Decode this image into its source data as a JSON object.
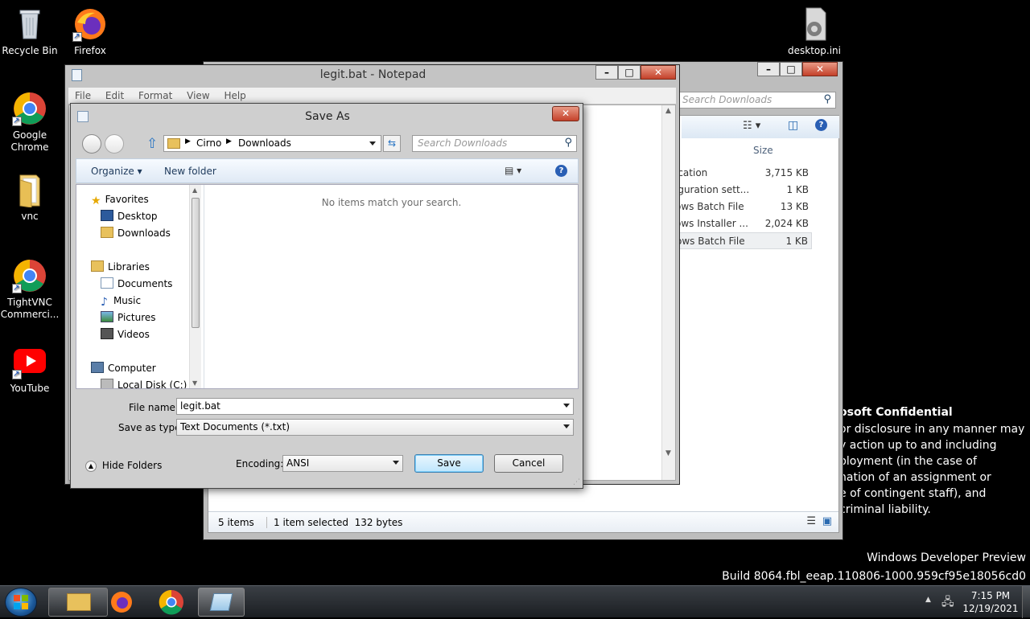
{
  "desktop": {
    "icons": [
      {
        "label": "Recycle Bin"
      },
      {
        "label": "Firefox"
      },
      {
        "label": "Google Chrome"
      },
      {
        "label": "vnc"
      },
      {
        "label": "TightVNC Commerci..."
      },
      {
        "label": "YouTube"
      },
      {
        "label": "desktop.ini"
      }
    ],
    "watermark": {
      "confidential_title": "osoft Confidential",
      "lines": [
        "or disclosure in any manner may",
        "y action up to and including",
        "ployment (in the case of",
        "nation of an assignment or",
        "e of contingent staff), and",
        "criminal liability."
      ],
      "edition": "Windows Developer Preview",
      "build": "Build 8064.fbl_eeap.110806-1000.959cf95e18056cd0"
    }
  },
  "explorer_bg": {
    "search_placeholder": "Search Downloads",
    "size_header": "Size",
    "rows": [
      {
        "type": "ication",
        "size": "3,715 KB"
      },
      {
        "type": "iguration sett...",
        "size": "1 KB"
      },
      {
        "type": "ows Batch File",
        "size": "13 KB"
      },
      {
        "type": "ows Installer ...",
        "size": "2,024 KB"
      },
      {
        "type": "ows Batch File",
        "size": "1 KB"
      }
    ],
    "status": {
      "items": "5 items",
      "selected": "1 item selected  132 bytes"
    }
  },
  "notepad": {
    "title": "legit.bat - Notepad",
    "menu": [
      "File",
      "Edit",
      "Format",
      "View",
      "Help"
    ]
  },
  "save_dialog": {
    "title": "Save As",
    "breadcrumb": [
      "Cirno",
      "Downloads"
    ],
    "search_placeholder": "Search Downloads",
    "toolbar": {
      "organize": "Organize",
      "new_folder": "New folder"
    },
    "nav": {
      "favorites": "Favorites",
      "desktop": "Desktop",
      "downloads": "Downloads",
      "libraries": "Libraries",
      "documents": "Documents",
      "music": "Music",
      "pictures": "Pictures",
      "videos": "Videos",
      "computer": "Computer",
      "local_disk": "Local Disk (C:)"
    },
    "empty_message": "No items match your search.",
    "file_name_label": "File name:",
    "file_name_value": "legit.bat",
    "save_type_label": "Save as type:",
    "save_type_value": "Text Documents (*.txt)",
    "hide_folders": "Hide Folders",
    "encoding_label": "Encoding:",
    "encoding_value": "ANSI",
    "save_label": "Save",
    "cancel_label": "Cancel"
  },
  "taskbar": {
    "time": "7:15 PM",
    "date": "12/19/2021"
  }
}
